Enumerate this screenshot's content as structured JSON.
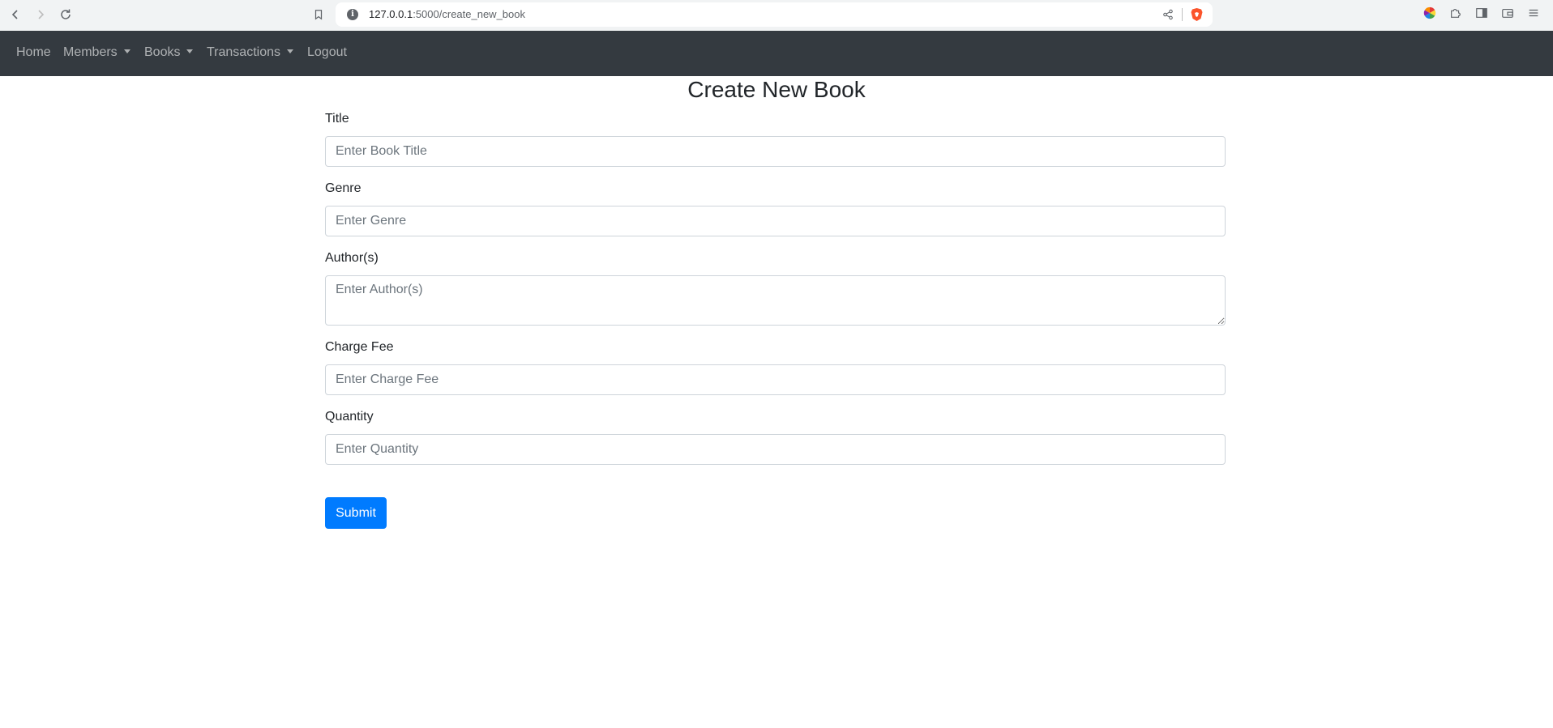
{
  "browser": {
    "url_host": "127.0.0.1",
    "url_rest": ":5000/create_new_book",
    "icons": [
      "back-icon",
      "forward-icon",
      "reload-icon",
      "bookmark-icon",
      "site-info-icon",
      "share-icon",
      "brave-shield-icon",
      "color-wheel-icon",
      "puzzle-icon",
      "sidebar-icon",
      "wallet-icon",
      "menu-icon"
    ]
  },
  "navbar": {
    "home": "Home",
    "members": "Members",
    "books": "Books",
    "transactions": "Transactions",
    "logout": "Logout"
  },
  "page": {
    "title": "Create New Book"
  },
  "form": {
    "title_label": "Title",
    "title_placeholder": "Enter Book Title",
    "genre_label": "Genre",
    "genre_placeholder": "Enter Genre",
    "authors_label": "Author(s)",
    "authors_placeholder": "Enter Author(s)",
    "fee_label": "Charge Fee",
    "fee_placeholder": "Enter Charge Fee",
    "quantity_label": "Quantity",
    "quantity_placeholder": "Enter Quantity",
    "submit_label": "Submit"
  },
  "colors": {
    "navbar_bg": "#343a40",
    "primary": "#007bff"
  }
}
